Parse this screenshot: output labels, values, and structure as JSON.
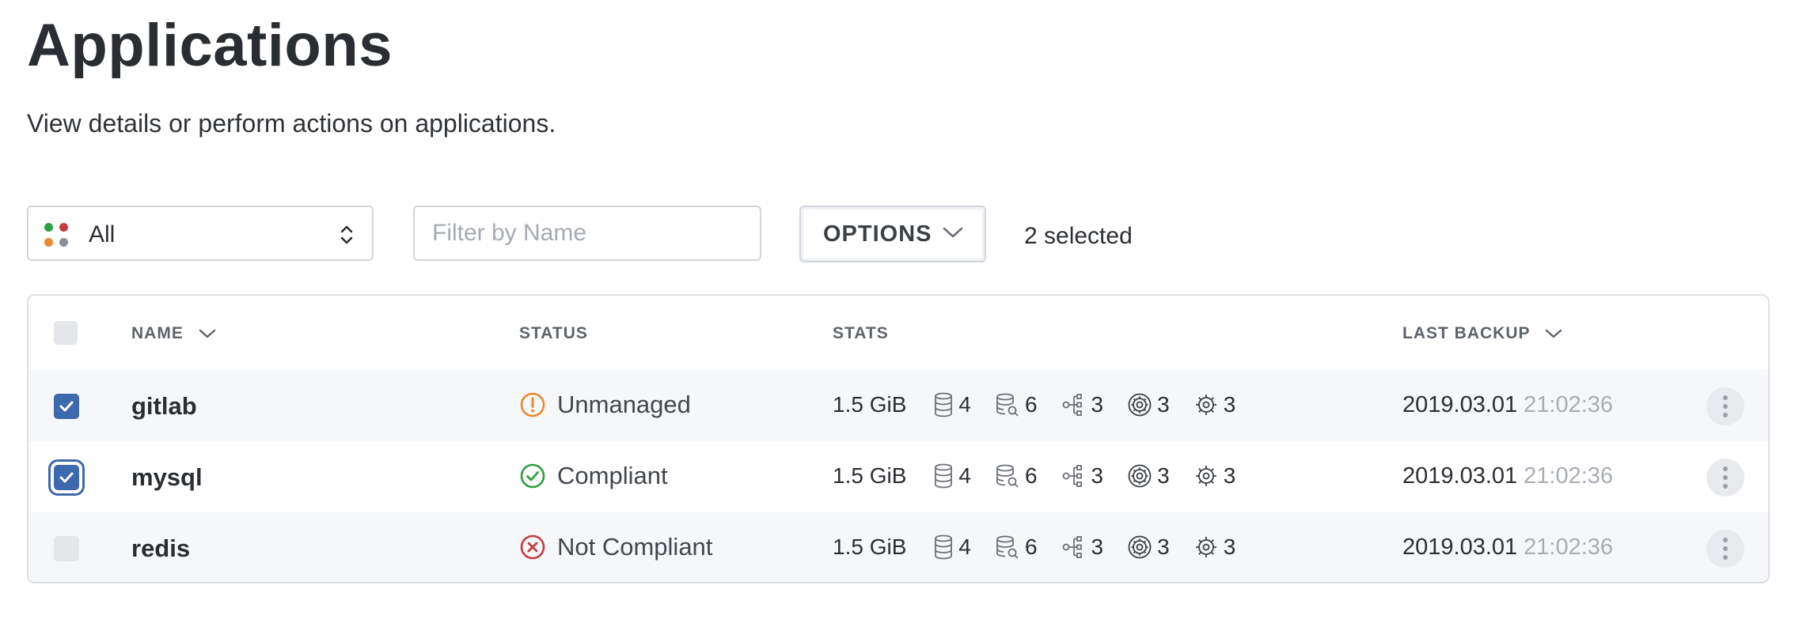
{
  "page": {
    "title": "Applications",
    "subtitle": "View details or perform actions on applications."
  },
  "toolbar": {
    "scope_value": "All",
    "filter_placeholder": "Filter by Name",
    "options_label": "OPTIONS",
    "selected_text": "2 selected"
  },
  "table": {
    "columns": {
      "name": "NAME",
      "status": "STATUS",
      "stats": "STATS",
      "last_backup": "LAST BACKUP"
    },
    "rows": [
      {
        "name": "gitlab",
        "checked": true,
        "status": "Unmanaged",
        "status_icon": "warning-circle-icon",
        "status_color": "#e8892b",
        "size": "1.5 GiB",
        "volumes": "4",
        "snapshots": "6",
        "pods": "3",
        "resources": "3",
        "configs": "3",
        "backup_date": "2019.03.01",
        "backup_time": "21:02:36"
      },
      {
        "name": "mysql",
        "checked": true,
        "status": "Compliant",
        "status_icon": "check-circle-icon",
        "status_color": "#2e9e3f",
        "size": "1.5 GiB",
        "volumes": "4",
        "snapshots": "6",
        "pods": "3",
        "resources": "3",
        "configs": "3",
        "backup_date": "2019.03.01",
        "backup_time": "21:02:36"
      },
      {
        "name": "redis",
        "checked": false,
        "status": "Not Compliant",
        "status_icon": "error-circle-icon",
        "status_color": "#c43d3d",
        "size": "1.5 GiB",
        "volumes": "4",
        "snapshots": "6",
        "pods": "3",
        "resources": "3",
        "configs": "3",
        "backup_date": "2019.03.01",
        "backup_time": "21:02:36"
      }
    ]
  },
  "colors": {
    "accent": "#3d69ad",
    "scope_dots": [
      "#2e9e3f",
      "#c43d3d",
      "#e8892b",
      "#8a9099"
    ]
  }
}
